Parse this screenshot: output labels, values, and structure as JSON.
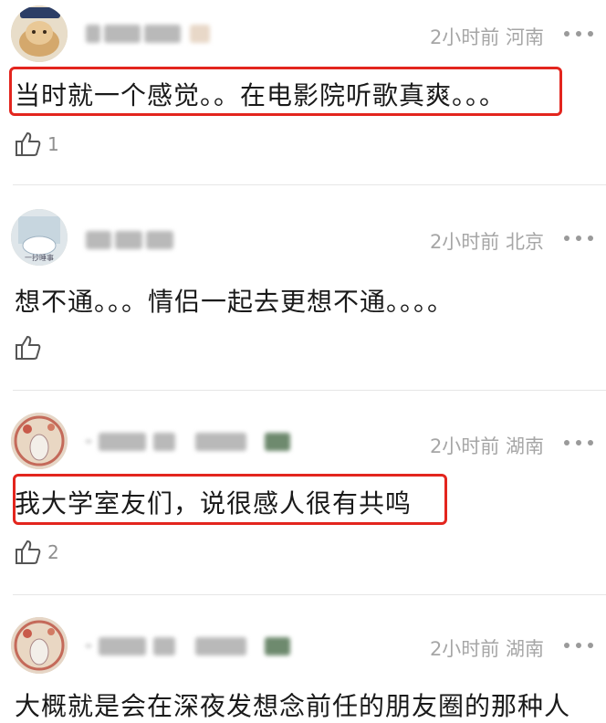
{
  "comments": [
    {
      "time": "2小时前",
      "location": "河南",
      "text": "当时就一个感觉。。在电影院听歌真爽。。。",
      "likes": "1"
    },
    {
      "time": "2小时前",
      "location": "北京",
      "text": "想不通。。。情侣一起去更想不通。。。。",
      "likes": ""
    },
    {
      "time": "2小时前",
      "location": "湖南",
      "text": "我大学室友们，说很感人很有共鸣",
      "likes": "2"
    },
    {
      "time": "2小时前",
      "location": "湖南",
      "text": "大概就是会在深夜发想念前任的朋友圈的那种人",
      "likes": ""
    }
  ],
  "icons": {
    "like": "thumbs-up-icon",
    "more": "more-dots-icon"
  },
  "colors": {
    "highlight": "#e3251e",
    "meta": "#a6a6a6"
  }
}
